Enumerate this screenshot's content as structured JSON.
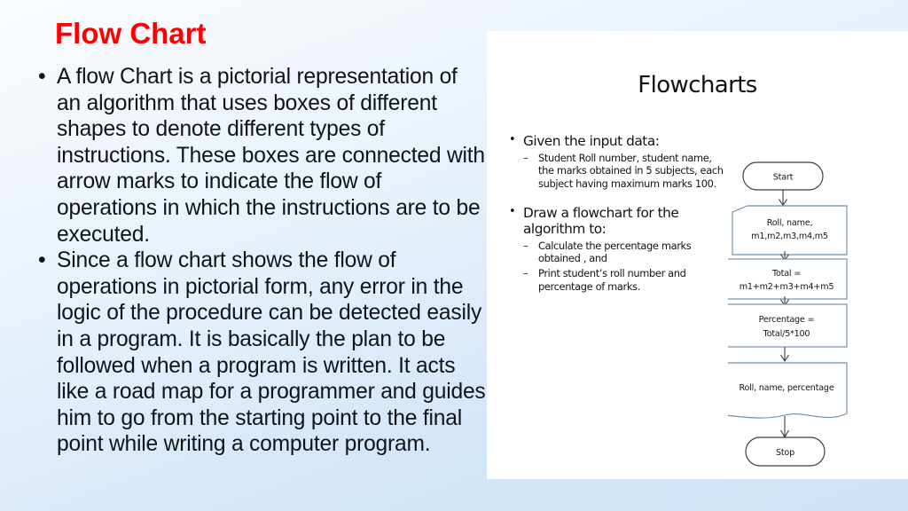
{
  "slide": {
    "title": "Flow Chart",
    "title_color": "#ff0000",
    "background_colors": [
      "#fafcfe",
      "#e3eefb",
      "#cfe2f7"
    ],
    "bullets": [
      "A flow Chart is a pictorial representation of an algorithm that uses boxes of different shapes to denote different types of instructions. These boxes are connected with arrow marks to indicate the flow of operations in which the instructions are to be executed.",
      "Since a flow chart shows the flow of operations in pictorial form, any error in the logic of the procedure can be detected easily in a program. It is basically the plan to be followed when a program is written. It acts like a road map for a programmer and guides him to go from the starting point to the final point while writing a computer program."
    ],
    "bullet_marker": "•"
  },
  "embedded_slide": {
    "title": "Flowcharts",
    "bullet_marker": "•",
    "sub_marker": "–",
    "sections": [
      {
        "heading": "Given the input data:",
        "items": [
          "Student Roll number, student name, the marks obtained in 5 subjects, each subject having maximum marks 100."
        ]
      },
      {
        "heading": "Draw a flowchart for the algorithm to:",
        "items": [
          "Calculate the percentage marks obtained , and",
          "Print student’s roll number and percentage of marks."
        ]
      }
    ]
  },
  "flowchart": {
    "shape_border_color": "#6e8da8",
    "terminator_border_color": "#3c3c3c",
    "nodes": [
      {
        "id": "start",
        "shape": "terminator",
        "lines": [
          "Start"
        ]
      },
      {
        "id": "input",
        "shape": "input-data",
        "lines": [
          "Roll, name,",
          "m1,m2,m3,m4,m5"
        ]
      },
      {
        "id": "total",
        "shape": "process",
        "lines": [
          "Total =",
          "m1+m2+m3+m4+m5"
        ]
      },
      {
        "id": "percentage",
        "shape": "process",
        "lines": [
          "Percentage =",
          "Total/5*100"
        ]
      },
      {
        "id": "output",
        "shape": "document",
        "lines": [
          "Roll, name, percentage"
        ]
      },
      {
        "id": "stop",
        "shape": "terminator",
        "lines": [
          "Stop"
        ]
      }
    ],
    "edges": [
      {
        "from": "start",
        "to": "input"
      },
      {
        "from": "input",
        "to": "total"
      },
      {
        "from": "total",
        "to": "percentage"
      },
      {
        "from": "percentage",
        "to": "output"
      },
      {
        "from": "output",
        "to": "stop"
      }
    ]
  }
}
